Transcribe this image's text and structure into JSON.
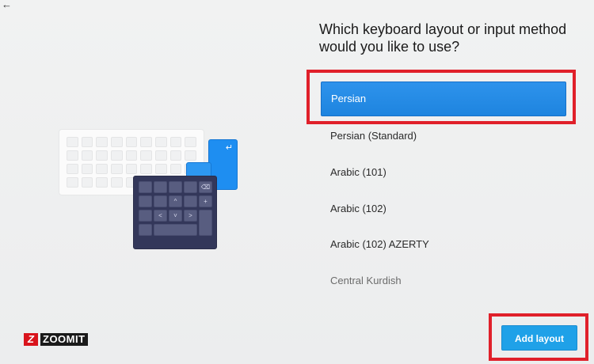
{
  "header": {
    "back_icon": "back-arrow-icon"
  },
  "setup": {
    "question": "Which keyboard layout or input method would you like to use?",
    "layouts": [
      {
        "label": "Persian",
        "selected": true
      },
      {
        "label": "Persian (Standard)",
        "selected": false
      },
      {
        "label": "Arabic (101)",
        "selected": false
      },
      {
        "label": "Arabic (102)",
        "selected": false
      },
      {
        "label": "Arabic (102) AZERTY",
        "selected": false
      },
      {
        "label": "Central Kurdish",
        "selected": false
      }
    ],
    "add_layout_label": "Add layout"
  },
  "illustration": {
    "numpad_keys": [
      "⌫",
      "+",
      "^",
      "<",
      "˅",
      ">"
    ]
  },
  "watermark": {
    "icon_text": "Z",
    "text": "ZOOMIT"
  },
  "colors": {
    "accent": "#1e84df",
    "highlight": "#e0202a",
    "button": "#1fa1e8"
  }
}
